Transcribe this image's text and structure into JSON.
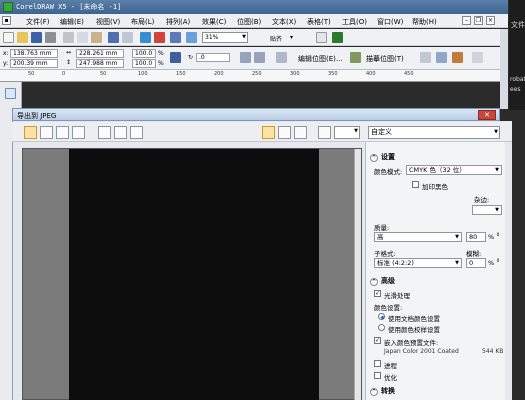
{
  "app": {
    "title": "CorelDRAW X5 - [未命名 -1]"
  },
  "menu": [
    "文件(F)",
    "编辑(E)",
    "视图(V)",
    "布局(L)",
    "排列(A)",
    "效果(C)",
    "位图(B)",
    "文本(X)",
    "表格(T)",
    "工具(O)",
    "窗口(W)",
    "帮助(H)"
  ],
  "toolbar": {
    "zoom_value": "31%",
    "snap_label": "贴齐",
    "edit_bitmap_label": "编辑位图(E)...",
    "trace_bitmap_label": "描摹位图(T)"
  },
  "props": {
    "x": "138.763 mm",
    "y": "200.39 mm",
    "w": "228.261 mm",
    "h": "247.988 mm",
    "sx": "100.0",
    "sy": "100.0",
    "pct": "%",
    "angle": ".0",
    "x_label": "x:",
    "y_label": "y:"
  },
  "ruler_ticks": [
    "50",
    "0",
    "50",
    "100",
    "150",
    "200",
    "250",
    "300",
    "350",
    "400",
    "450"
  ],
  "side": {
    "line1": "文件",
    "line2": "robat",
    "line3": "ees"
  },
  "dialog": {
    "title": "导出到 JPEG",
    "close": "✕",
    "preset": "自定义",
    "settings": {
      "header": "设置",
      "color_mode_label": "颜色模式:",
      "color_mode_value": "CMYK 色（32 位）",
      "overprint_label": "加印黑色",
      "noise_label": "杂边:",
      "quality_label": "质量:",
      "quality_value": "高",
      "quality_num": "80",
      "quality_unit": "%",
      "subformat_label": "子格式:",
      "subformat_value": "标准 (4:2:2)",
      "blur_label": "模糊:",
      "blur_value": "0",
      "blur_unit": "%"
    },
    "advanced": {
      "header": "高级",
      "smoothing_label": "光滑处理",
      "color_settings_label": "颜色设置:",
      "opt_doc": "使用文档颜色设置",
      "opt_proof": "使用颜色校样设置",
      "embed_label": "嵌入颜色预置文件:",
      "profile_name": "Japan Color 2001 Coated",
      "profile_size": "544 KB",
      "progressive_label": "进程",
      "optimize_label": "优化"
    },
    "transform": {
      "header": "转换"
    }
  }
}
